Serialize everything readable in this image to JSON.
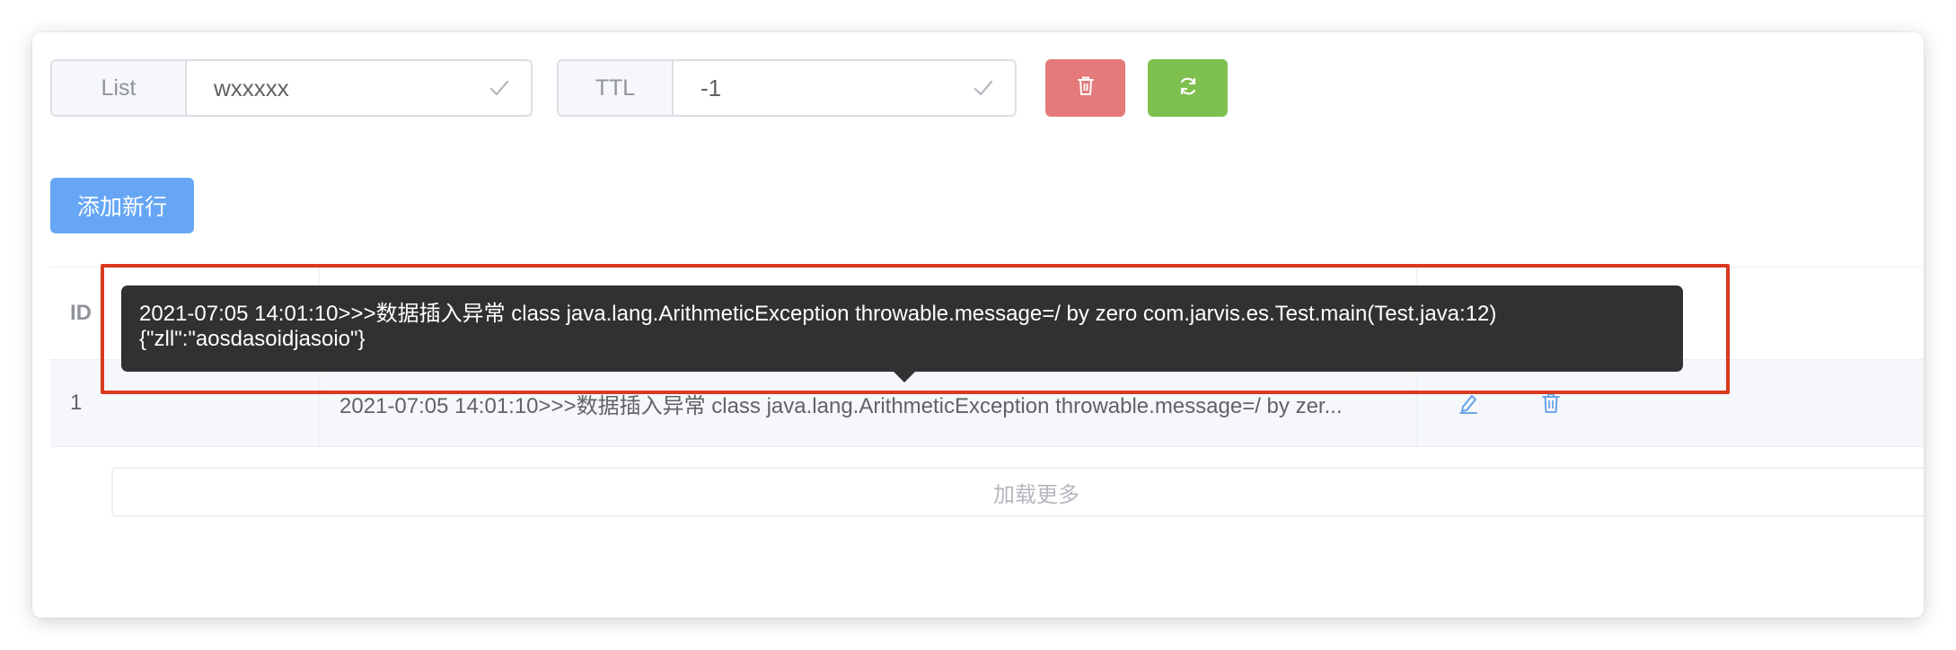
{
  "toolbar": {
    "key_type_label": "List",
    "key_value": "wxxxxx",
    "ttl_label": "TTL",
    "ttl_value": "-1",
    "delete_color": "#e47a7a",
    "refresh_color": "#7ec050"
  },
  "add_row_button": "添加新行",
  "table": {
    "columns": [
      "ID",
      "",
      ""
    ],
    "rows": [
      {
        "id": "1",
        "value": "2021-07:05 14:01:10>>>数据插入异常 class java.lang.ArithmeticException throwable.message=/ by zer..."
      }
    ]
  },
  "tooltip": {
    "line1": "2021-07:05 14:01:10>>>数据插入异常 class java.lang.ArithmeticException throwable.message=/ by zero com.jarvis.es.Test.main(Test.java:12)",
    "line2": "{\"zll\":\"aosdasoidjasoio\"}"
  },
  "load_more": "加载更多",
  "icons": [
    "check-icon",
    "trash-icon",
    "refresh-icon",
    "edit-icon",
    "delete-icon"
  ],
  "accent_color": "#66a6f5",
  "highlight_color": "#d9391f"
}
